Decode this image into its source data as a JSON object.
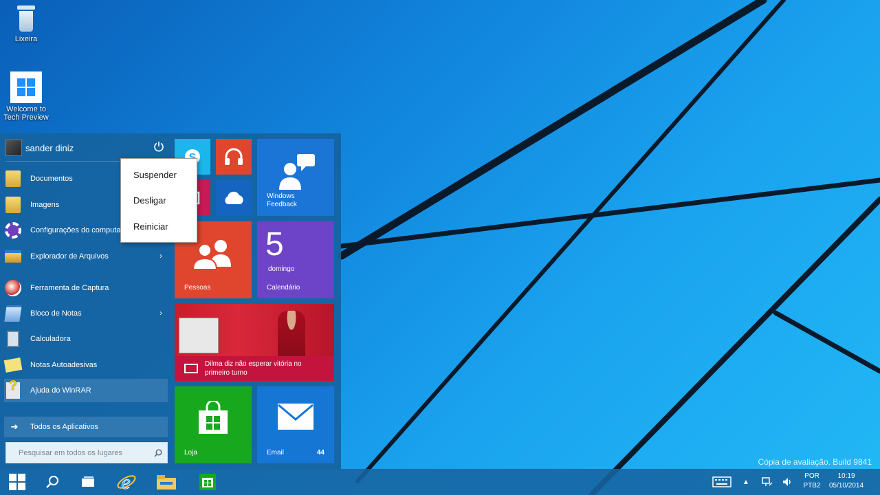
{
  "desktop": {
    "icons": [
      {
        "label": "Lixeira"
      },
      {
        "label": "Welcome to Tech Preview"
      }
    ],
    "watermark": "Cópia de avaliação. Build 9841"
  },
  "start_menu": {
    "user_name": "sander diniz",
    "items": [
      {
        "label": "Documentos",
        "icon": "folder-icon",
        "has_submenu": false
      },
      {
        "label": "Imagens",
        "icon": "pictures-folder-icon",
        "has_submenu": false
      },
      {
        "label": "Configurações do computador",
        "icon": "gear-icon",
        "has_submenu": false
      },
      {
        "label": "Explorador de Arquivos",
        "icon": "file-explorer-icon",
        "has_submenu": true
      },
      {
        "label": "Ferramenta de Captura",
        "icon": "snipping-tool-icon",
        "has_submenu": false
      },
      {
        "label": "Bloco de Notas",
        "icon": "notepad-icon",
        "has_submenu": true
      },
      {
        "label": "Calculadora",
        "icon": "calculator-icon",
        "has_submenu": false
      },
      {
        "label": "Notas Autoadesivas",
        "icon": "sticky-notes-icon",
        "has_submenu": false
      },
      {
        "label": "Ajuda do WinRAR",
        "icon": "winrar-help-icon",
        "has_submenu": false
      }
    ],
    "all_apps_label": "Todos os Aplicativos",
    "search_placeholder": "Pesquisar em todos os lugares"
  },
  "power_menu": {
    "options": [
      "Suspender",
      "Desligar",
      "Reiniciar"
    ]
  },
  "tiles": {
    "feedback_label": "Windows Feedback",
    "people_label": "Pessoas",
    "calendar_day": "5",
    "calendar_weekday": "domingo",
    "calendar_label": "Calendário",
    "news_headline": "Dilma diz não esperar vitória no primeiro turno",
    "store_label": "Loja",
    "mail_label": "Email",
    "mail_count": "44"
  },
  "taskbar": {
    "lang_top": "POR",
    "lang_bottom": "PTB2",
    "time": "10:19",
    "date": "05/10/2014"
  },
  "colors": {
    "skype": "#1cb6ec",
    "music": "#e0452d",
    "feedback": "#1b75d6",
    "onedrive": "#1565c0",
    "people": "#e0452d",
    "calendar": "#6d43c7",
    "news": "#c4143e",
    "store": "#18a81e",
    "mail": "#1576d3"
  }
}
